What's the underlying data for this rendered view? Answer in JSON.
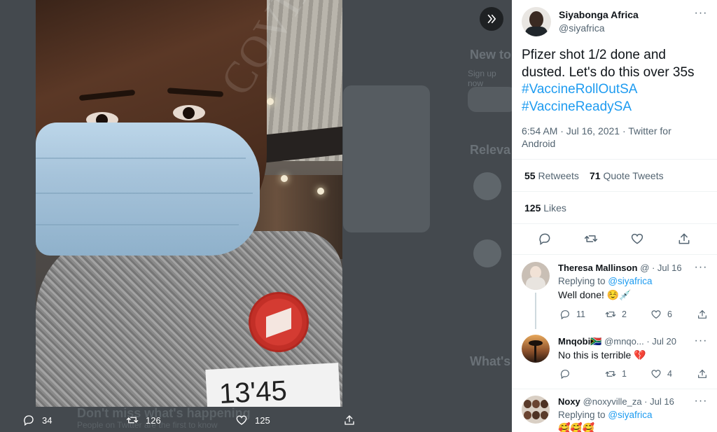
{
  "background_page": {
    "heading_new": "New to",
    "signup_hint": "Sign up now",
    "heading_relevant": "Releva",
    "heading_whats": "What's",
    "bottom_heading": "Don't miss what's happening",
    "bottom_sub": "People on Twitter are the first to know"
  },
  "watermark": "COVIDBlog.Com",
  "name_tag_text": "13'45",
  "media_actions": {
    "replies": "34",
    "retweets": "126",
    "likes": "125"
  },
  "tweet": {
    "author_name": "Siyabonga Africa",
    "author_handle": "@siyafrica",
    "text_line1": "Pfizer shot 1/2 done and",
    "text_line2": "dusted. Let's do this over 35s",
    "hashtag1": "#VaccineRollOutSA",
    "hashtag2": "#VaccineReadySA",
    "timestamp": "6:54 AM · Jul 16, 2021 · Twitter for",
    "client": "Android",
    "retweets_count": "55",
    "retweets_label": "Retweets",
    "quotes_count": "71",
    "quotes_label": "Quote Tweets",
    "likes_count": "125",
    "likes_label": "Likes"
  },
  "replies": [
    {
      "name": "Theresa Mallinson",
      "handle_date": "@ · Jul 16",
      "replying_to_label": "Replying to",
      "replying_to": "@siyafrica",
      "text": "Well done! ☺️💉",
      "reply_count": "11",
      "retweet_count": "2",
      "like_count": "6"
    },
    {
      "name": "Mnqobi🇿🇦",
      "handle_date": "@mnqo... · Jul 20",
      "text": "No this is terrible 💔",
      "reply_count": "",
      "retweet_count": "1",
      "like_count": "4"
    },
    {
      "name": "Noxy",
      "handle_date": "@noxyville_za · Jul 16",
      "replying_to_label": "Replying to",
      "replying_to": "@siyafrica",
      "text": "🥰🥰🥰"
    }
  ],
  "colors": {
    "accent": "#1d9bf0",
    "text_primary": "#0f1419",
    "text_secondary": "#536471",
    "viewer_bg": "#3a3f44"
  },
  "icons": [
    "expand-icon",
    "reply-icon",
    "retweet-icon",
    "like-icon",
    "share-icon",
    "more-icon"
  ]
}
